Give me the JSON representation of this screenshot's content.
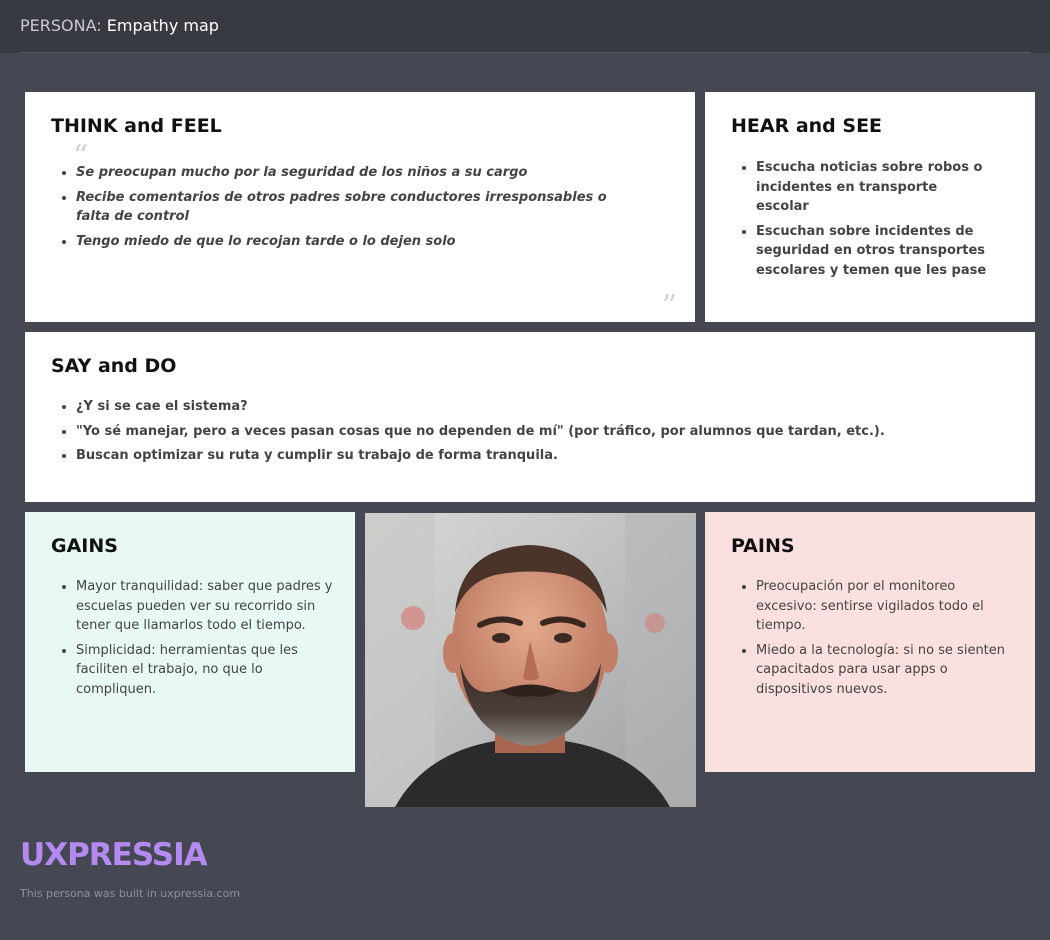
{
  "header": {
    "prefix": "PERSONA:",
    "title": "Empathy map"
  },
  "think_feel": {
    "title": "THINK and FEEL",
    "open_quote": "“",
    "close_quote": "”",
    "items": [
      "Se preocupan mucho por la seguridad de los niños a su cargo",
      "Recibe comentarios de otros padres sobre conductores irresponsables o falta de control",
      "Tengo miedo de que lo recojan tarde o lo dejen solo"
    ]
  },
  "hear_see": {
    "title": "HEAR and SEE",
    "items": [
      "Escucha noticias sobre robos o incidentes en transporte escolar",
      "Escuchan sobre incidentes de seguridad en otros transportes escolares y temen que les pase"
    ]
  },
  "say_do": {
    "title": "SAY and DO",
    "items": [
      "¿Y si se cae el sistema?",
      "\"Yo sé manejar, pero a veces pasan cosas que no dependen de mí\" (por tráfico, por alumnos que tardan, etc.).",
      "Buscan optimizar su ruta y cumplir su trabajo de forma tranquila."
    ]
  },
  "gains": {
    "title": "GAINS",
    "items": [
      "Mayor tranquilidad: saber que padres y escuelas pueden ver su recorrido sin tener que llamarlos todo el tiempo.",
      "Simplicidad: herramientas que les faciliten el trabajo, no que lo compliquen."
    ]
  },
  "pains": {
    "title": "PAINS",
    "items": [
      "Preocupación por el monitoreo excesivo: sentirse vigilados todo el tiempo.",
      "Miedo a la tecnología: si no se sienten capacitados para usar apps o dispositivos nuevos."
    ]
  },
  "footer": {
    "logo": "UXPRESSIA",
    "note": "This persona was built in uxpressia.com"
  },
  "colors": {
    "background": "#454852",
    "gains_bg": "#e8f8f4",
    "pains_bg": "#fae0df",
    "logo": "#b58af0"
  }
}
